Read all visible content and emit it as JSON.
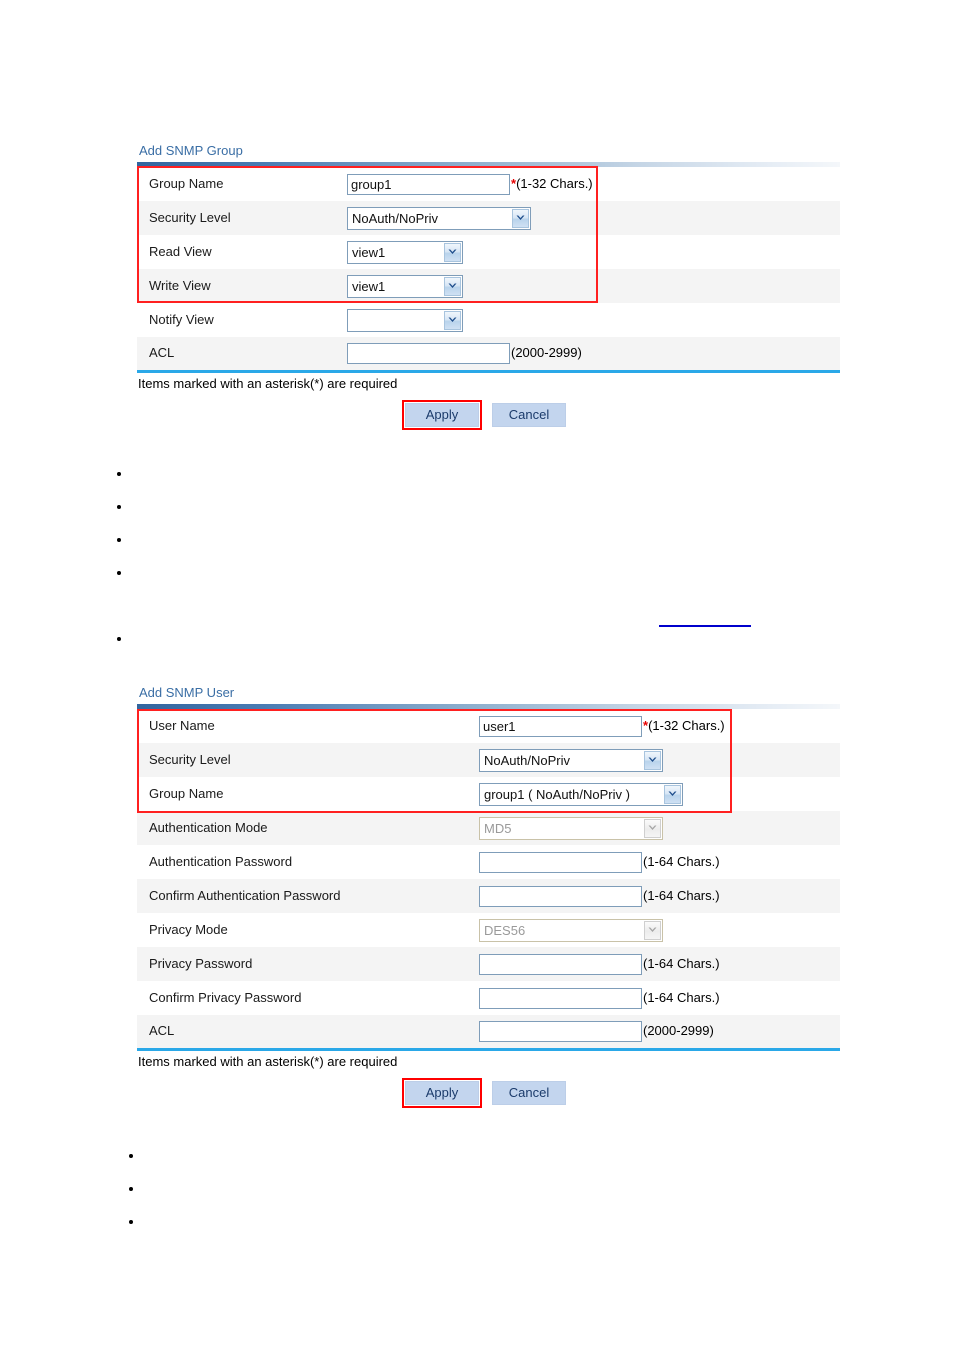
{
  "page": {
    "background": "#ffffff",
    "accent_title_color": "#3A6EA5",
    "table_bottom_rule_color": "#2AA8E8",
    "highlight_box_color": "#ff2020",
    "required_star_color": "#e60000",
    "link_color": "#0000cc",
    "button_face_color": "#c3d5ee",
    "button_text_color": "#1b3b6b"
  },
  "snmp_group": {
    "title": "Add SNMP Group",
    "rows": [
      {
        "label": "Group Name",
        "control": "text",
        "value": "group1",
        "placeholder": "",
        "required": true,
        "required_mark": "*",
        "hint": "(1-32 Chars.)"
      },
      {
        "label": "Security Level",
        "control": "select",
        "value": "NoAuth/NoPriv",
        "hint": ""
      },
      {
        "label": "Read View",
        "control": "select",
        "value": "view1",
        "hint": ""
      },
      {
        "label": "Write View",
        "control": "select",
        "value": "view1",
        "hint": ""
      },
      {
        "label": "Notify View",
        "control": "select",
        "value": "",
        "hint": ""
      },
      {
        "label": "ACL",
        "control": "text",
        "value": "",
        "placeholder": "",
        "required": false,
        "hint": "(2000-2999)"
      }
    ],
    "footnote": "Items marked with an asterisk(*) are required",
    "buttons": {
      "apply": "Apply",
      "cancel": "Cancel"
    }
  },
  "snmp_user": {
    "title": "Add SNMP User",
    "rows": [
      {
        "label": "User Name",
        "control": "text",
        "value": "user1",
        "placeholder": "",
        "required": true,
        "required_mark": "*",
        "hint": "(1-32 Chars.)"
      },
      {
        "label": "Security Level",
        "control": "select",
        "value": "NoAuth/NoPriv",
        "hint": ""
      },
      {
        "label": "Group Name",
        "control": "select",
        "value": "group1  ( NoAuth/NoPriv )",
        "hint": ""
      },
      {
        "label": "Authentication Mode",
        "control": "select-disabled",
        "value": "MD5",
        "hint": ""
      },
      {
        "label": "Authentication Password",
        "control": "text",
        "value": "",
        "placeholder": "",
        "required": false,
        "hint": "(1-64 Chars.)"
      },
      {
        "label": "Confirm Authentication Password",
        "control": "text",
        "value": "",
        "placeholder": "",
        "required": false,
        "hint": "(1-64 Chars.)"
      },
      {
        "label": "Privacy Mode",
        "control": "select-disabled",
        "value": "DES56",
        "hint": ""
      },
      {
        "label": "Privacy Password",
        "control": "text",
        "value": "",
        "placeholder": "",
        "required": false,
        "hint": "(1-64 Chars.)"
      },
      {
        "label": "Confirm Privacy Password",
        "control": "text",
        "value": "",
        "placeholder": "",
        "required": false,
        "hint": "(1-64 Chars.)"
      },
      {
        "label": "ACL",
        "control": "text",
        "value": "",
        "placeholder": "",
        "required": false,
        "hint": "(2000-2999)"
      }
    ],
    "footnote": "Items marked with an asterisk(*) are required",
    "buttons": {
      "apply": "Apply",
      "cancel": "Cancel"
    }
  },
  "bullets_upper": [
    "",
    "",
    "",
    "",
    ""
  ],
  "bullets_lower": [
    "",
    "",
    ""
  ]
}
